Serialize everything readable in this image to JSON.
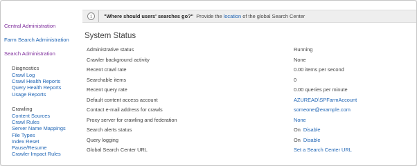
{
  "nav": {
    "links": [
      {
        "label": "Central Administration",
        "style": "visited"
      },
      {
        "label": "Farm Search Administration",
        "style": "blue"
      },
      {
        "label": "Search Administration",
        "style": "visited"
      }
    ],
    "diagnostics": {
      "heading": "Diagnostics",
      "items": [
        "Crawl Log",
        "Crawl Health Reports",
        "Query Health Reports",
        "Usage Reports"
      ]
    },
    "crawling": {
      "heading": "Crawling",
      "items": [
        "Content Sources",
        "Crawl Rules",
        "Server Name Mappings",
        "File Types",
        "Index Reset",
        "Pause/Resume",
        "Crawler Impact Rules"
      ]
    }
  },
  "infobar": {
    "icon": "info-icon",
    "question": "\"Where should users' searches go?\"",
    "text_before": "Provide the",
    "link": "location",
    "text_after": "of the global Search Center"
  },
  "main": {
    "title": "System Status",
    "rows": [
      {
        "label": "Administrative status",
        "value": "Running"
      },
      {
        "label": "Crawler background activity",
        "value": "None"
      },
      {
        "label": "Recent crawl rate",
        "value": "0.00 items per second"
      },
      {
        "label": "Searchable items",
        "value": "0"
      },
      {
        "label": "Recent query rate",
        "value": "0.00 queries per minute"
      },
      {
        "label": "Default content access account",
        "link": "AZUREAD\\SPFarmAccount"
      },
      {
        "label": "Contact e-mail address for crawls",
        "link": "someone@example.com"
      },
      {
        "label": "Proxy server for crawling and federation",
        "link": "None"
      },
      {
        "label": "Search alerts status",
        "prefix": "On",
        "link": "Disable"
      },
      {
        "label": "Query logging",
        "prefix": "On",
        "link": "Disable"
      },
      {
        "label": "Global Search Center URL",
        "link": "Set a Search Center URL"
      }
    ]
  },
  "colors": {
    "link": "#1e64b4",
    "visited": "#7d2b9b",
    "text": "#444444",
    "infobar_bg": "#eeeeee"
  }
}
